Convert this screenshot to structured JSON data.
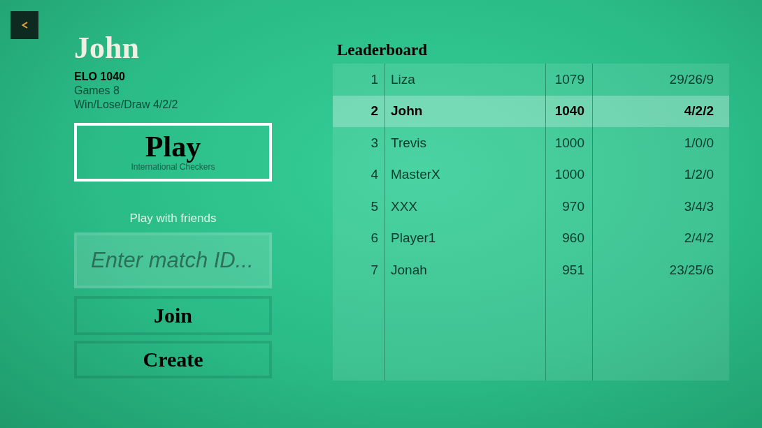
{
  "profile": {
    "name": "John",
    "elo": "ELO 1040",
    "games": "Games 8",
    "record": "Win/Lose/Draw 4/2/2"
  },
  "play_button": {
    "label": "Play",
    "subtitle": "International Checkers"
  },
  "friends": {
    "heading": "Play with friends",
    "match_id_field": {
      "placeholder": "Enter match ID..."
    },
    "buttons": [
      "Join",
      "Create"
    ]
  },
  "leaderboard": {
    "title": "Leaderboard",
    "rows": [
      {
        "rank": "1",
        "name": "Liza",
        "elo": "1079",
        "record": "29/26/9",
        "selected": false
      },
      {
        "rank": "2",
        "name": "John",
        "elo": "1040",
        "record": "4/2/2",
        "selected": true
      },
      {
        "rank": "3",
        "name": "Trevis",
        "elo": "1000",
        "record": "1/0/0",
        "selected": false
      },
      {
        "rank": "4",
        "name": "MasterX",
        "elo": "1000",
        "record": "1/2/0",
        "selected": false
      },
      {
        "rank": "5",
        "name": "XXX",
        "elo": "970",
        "record": "3/4/3",
        "selected": false
      },
      {
        "rank": "6",
        "name": "Player1",
        "elo": "960",
        "record": "2/4/2",
        "selected": false
      },
      {
        "rank": "7",
        "name": "Jonah",
        "elo": "951",
        "record": "23/25/6",
        "selected": false
      }
    ]
  }
}
